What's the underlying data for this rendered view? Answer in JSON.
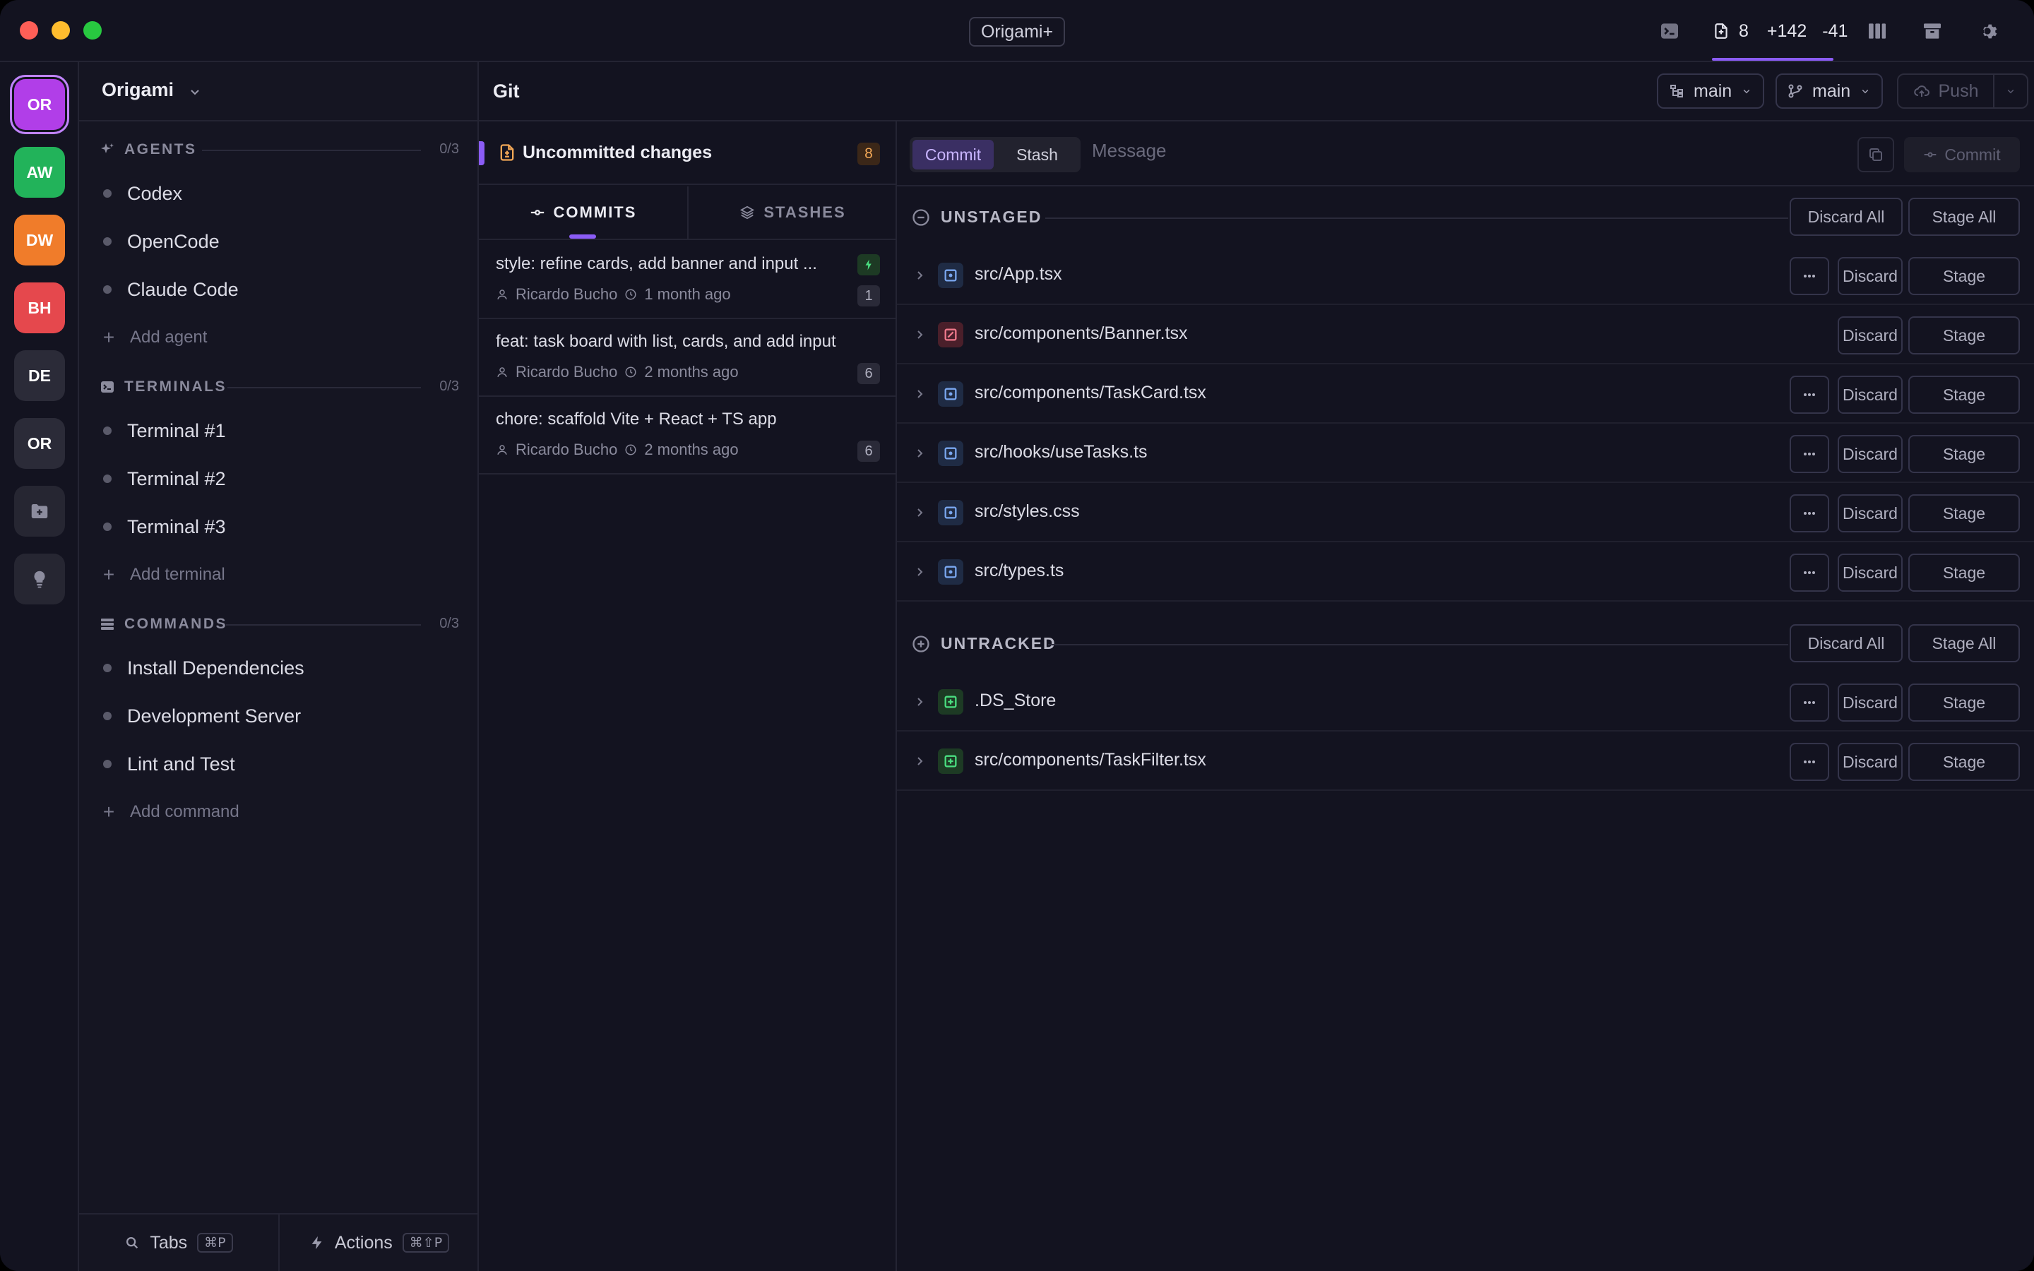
{
  "window": {
    "title": "Origami+"
  },
  "titlebar": {
    "changed_files": "8",
    "additions": "+142",
    "deletions": "-41"
  },
  "projects": [
    {
      "initials": "OR",
      "color": "#b13ee8",
      "active": true
    },
    {
      "initials": "AW",
      "color": "#22b35a"
    },
    {
      "initials": "DW",
      "color": "#f07c2a"
    },
    {
      "initials": "BH",
      "color": "#e5484d"
    },
    {
      "initials": "DE",
      "color": "#2b2b38"
    },
    {
      "initials": "OR",
      "color": "#2b2b38"
    }
  ],
  "sidebar": {
    "project_name": "Origami",
    "agents": {
      "label": "AGENTS",
      "count": "0/3",
      "items": [
        "Codex",
        "OpenCode",
        "Claude Code"
      ],
      "add_label": "Add agent"
    },
    "terminals": {
      "label": "TERMINALS",
      "count": "0/3",
      "items": [
        "Terminal #1",
        "Terminal #2",
        "Terminal #3"
      ],
      "add_label": "Add terminal"
    },
    "commands": {
      "label": "COMMANDS",
      "count": "0/3",
      "items": [
        "Install Dependencies",
        "Development Server",
        "Lint and Test"
      ],
      "add_label": "Add command"
    },
    "footer": {
      "tabs_label": "Tabs",
      "tabs_shortcut": "⌘P",
      "actions_label": "Actions",
      "actions_shortcut": "⌘⇧P"
    }
  },
  "git": {
    "title": "Git",
    "branch_base": "main",
    "branch_current": "main",
    "push_label": "Push",
    "uncommitted": {
      "label": "Uncommitted changes",
      "count": "8"
    },
    "tabs": {
      "commits": "COMMITS",
      "stashes": "STASHES"
    },
    "commits": [
      {
        "message": "style: refine cards, add banner and input ...",
        "author": "Ricardo Bucho",
        "time": "1 month ago",
        "count": "1"
      },
      {
        "message": "feat: task board with list, cards, and add input",
        "author": "Ricardo Bucho",
        "time": "2 months ago",
        "count": "6"
      },
      {
        "message": "chore: scaffold Vite + React + TS app",
        "author": "Ricardo Bucho",
        "time": "2 months ago",
        "count": "6"
      }
    ],
    "composer": {
      "commit_tab": "Commit",
      "stash_tab": "Stash",
      "message_placeholder": "Message",
      "commit_button": "Commit"
    },
    "unstaged": {
      "label": "UNSTAGED",
      "discard_all": "Discard All",
      "stage_all": "Stage All",
      "files": [
        {
          "path": "src/App.tsx",
          "status": "modified"
        },
        {
          "path": "src/components/Banner.tsx",
          "status": "deleted"
        },
        {
          "path": "src/components/TaskCard.tsx",
          "status": "modified"
        },
        {
          "path": "src/hooks/useTasks.ts",
          "status": "modified"
        },
        {
          "path": "src/styles.css",
          "status": "modified"
        },
        {
          "path": "src/types.ts",
          "status": "modified"
        }
      ]
    },
    "untracked": {
      "label": "UNTRACKED",
      "discard_all": "Discard All",
      "stage_all": "Stage All",
      "files": [
        {
          "path": ".DS_Store",
          "status": "added"
        },
        {
          "path": "src/components/TaskFilter.tsx",
          "status": "added"
        }
      ]
    },
    "row_actions": {
      "discard": "Discard",
      "stage": "Stage"
    }
  }
}
